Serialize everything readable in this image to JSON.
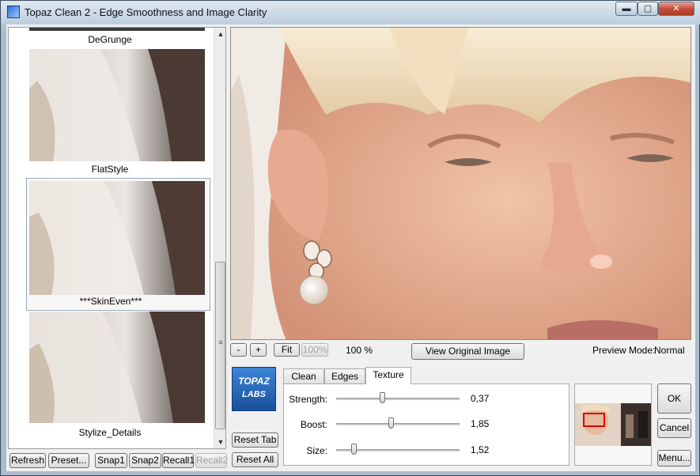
{
  "window": {
    "title": "Topaz Clean 2 - Edge Smoothness and Image Clarity",
    "minimize": "▬",
    "maximize": "▢",
    "close": "✕"
  },
  "thumbnails": [
    {
      "label": "DeGrunge"
    },
    {
      "label": "FlatStyle"
    },
    {
      "label": "***SkinEven***"
    },
    {
      "label": "Stylize_Details"
    }
  ],
  "scroll": {
    "up": "▲",
    "down": "▼",
    "grip": "≡"
  },
  "left_buttons": {
    "refresh": "Refresh",
    "preset": "Preset...",
    "snap1": "Snap1",
    "snap2": "Snap2",
    "recall1": "Recall1",
    "recall2": "Recall2"
  },
  "zoom": {
    "minus": "-",
    "plus": "+",
    "fit": "Fit",
    "hundred": "100%",
    "level": "100 %"
  },
  "view_original": "View Original Image",
  "preview_mode": {
    "label": "Preview Mode:",
    "value": "Normal"
  },
  "logo": {
    "line1": "TOPAZ",
    "line2": "LABS"
  },
  "reset_tab": "Reset Tab",
  "reset_all": "Reset All",
  "tabs": [
    {
      "label": "Clean",
      "active": false
    },
    {
      "label": "Edges",
      "active": false
    },
    {
      "label": "Texture",
      "active": true
    }
  ],
  "sliders": [
    {
      "label": "Strength:",
      "value": "0,37",
      "fraction": 0.37
    },
    {
      "label": "Boost:",
      "value": "1,85",
      "fraction": 0.44
    },
    {
      "label": "Size:",
      "value": "1,52",
      "fraction": 0.14
    }
  ],
  "actions": {
    "ok": "OK",
    "cancel": "Cancel",
    "menu": "Menu..."
  },
  "colors": {
    "accent": "#1f6fc0",
    "nav_box": "#e00000"
  }
}
